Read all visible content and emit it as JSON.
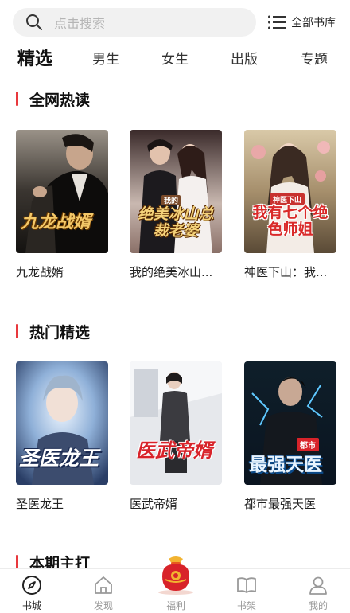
{
  "header": {
    "search_placeholder": "点击搜索",
    "library_label": "全部书库"
  },
  "tabs": [
    {
      "label": "精选",
      "active": true
    },
    {
      "label": "男生"
    },
    {
      "label": "女生"
    },
    {
      "label": "出版"
    },
    {
      "label": "专题"
    }
  ],
  "sections": [
    {
      "title": "全网热读",
      "books": [
        {
          "title": "九龙战婿",
          "cover_text": "九龙战婿"
        },
        {
          "title": "我的绝美冰山...",
          "cover_text_small": "我的",
          "cover_text": "绝美冰山总裁老婆"
        },
        {
          "title": "神医下山：我...",
          "cover_text_small": "神医下山",
          "cover_text": "我有七个绝色师姐"
        }
      ]
    },
    {
      "title": "热门精选",
      "books": [
        {
          "title": "圣医龙王",
          "cover_text": "圣医龙王"
        },
        {
          "title": "医武帝婿",
          "cover_text": "医武帝婿"
        },
        {
          "title": "都市最强天医",
          "cover_text_small": "都市",
          "cover_text": "最强天医"
        }
      ]
    },
    {
      "title": "本期主打",
      "books": []
    }
  ],
  "bottom_nav": [
    {
      "label": "书城",
      "icon": "compass-icon",
      "active": true
    },
    {
      "label": "发现",
      "icon": "home-icon"
    },
    {
      "label": "福利",
      "icon": "lucky-bag-icon"
    },
    {
      "label": "书架",
      "icon": "book-icon"
    },
    {
      "label": "我的",
      "icon": "user-icon"
    }
  ],
  "colors": {
    "accent": "#e8383d",
    "search_bg": "#f1f1f1",
    "nav_inactive": "#999999"
  }
}
